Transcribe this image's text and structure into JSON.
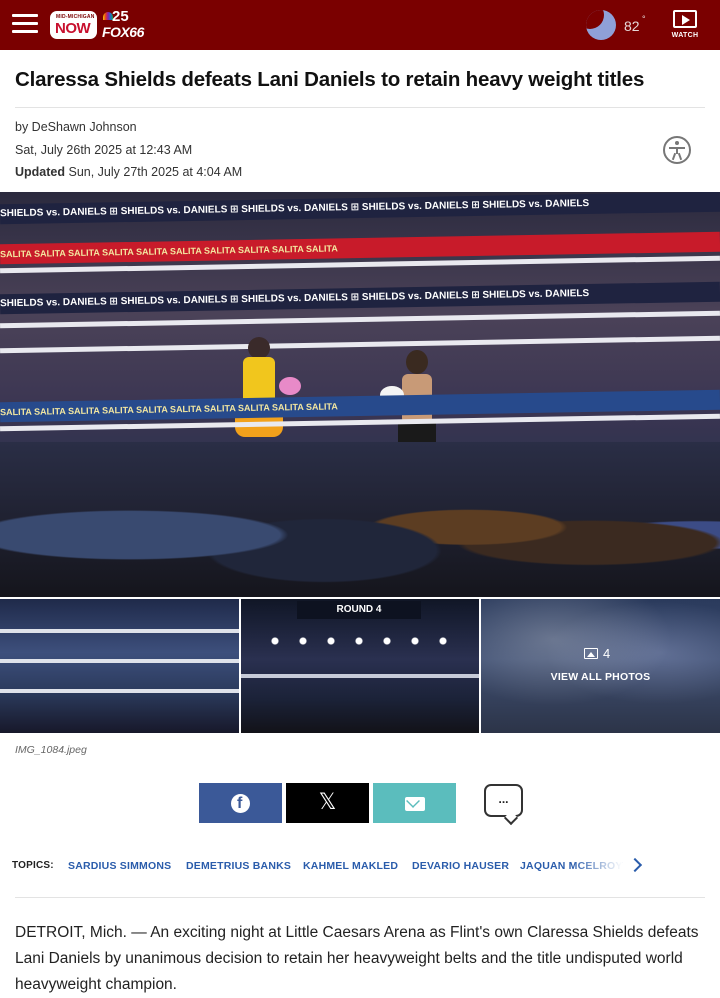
{
  "header": {
    "logo_small": "MID-MICHIGAN",
    "logo_now": "NOW",
    "logo_channel": "25",
    "logo_fox": "FOX66",
    "temperature": "82",
    "degree_symbol": "°",
    "watch_label": "WATCH",
    "bg_color": "#7a0000"
  },
  "article": {
    "headline": "Claressa Shields defeats Lani Daniels to retain heavy weight titles",
    "byline": "by DeShawn Johnson",
    "published": "Sat, July 26th 2025 at 12:43 AM",
    "updated_label": "Updated",
    "updated": "Sun, July 27th 2025 at 4:04 AM"
  },
  "photo": {
    "banner_text": "SHIELDS vs. DANIELS ⊞ SHIELDS vs. DANIELS ⊞ SHIELDS vs. DANIELS ⊞ SHIELDS vs. DANIELS ⊞ SHIELDS vs. DANIELS",
    "sponsor_text": "SALITA  SALITA  SALITA  SALITA  SALITA  SALITA  SALITA  SALITA  SALITA  SALITA",
    "caption": "IMG_1084.jpeg",
    "round_sign": "ROUND 4",
    "gallery_count": "4",
    "gallery_label": "VIEW ALL PHOTOS"
  },
  "share": {
    "facebook_color": "#3b5998",
    "x_color": "#000000",
    "email_color": "#5bbdbd",
    "x_glyph": "𝕏",
    "comment_glyph": "..."
  },
  "topics": {
    "label": "TOPICS:",
    "items": [
      "SARDIUS SIMMONS",
      "DEMETRIUS BANKS",
      "KAHMEL MAKLED",
      "DEVARIO HAUSER",
      "JAQUAN MCELROY"
    ],
    "link_color": "#2a5cab"
  },
  "body": {
    "paragraph_1": "DETROIT, Mich. — An exciting night at Little Caesars Arena as Flint's own Claressa Shields defeats Lani Daniels by unanimous decision to retain her heavyweight belts and the title undisputed world heavyweight champion."
  }
}
